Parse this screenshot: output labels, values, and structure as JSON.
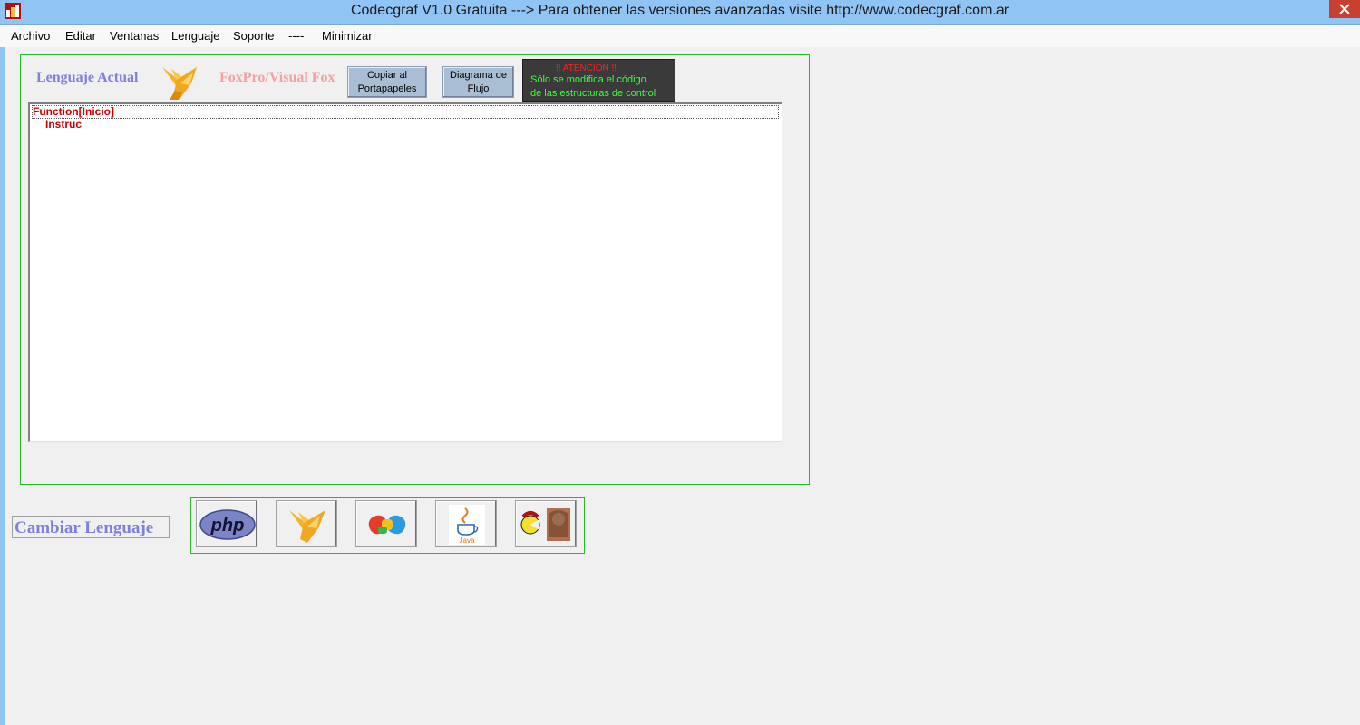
{
  "window": {
    "title": "Codecgraf V1.0 Gratuita ---> Para obtener las versiones avanzadas visite http://www.codecgraf.com.ar"
  },
  "menu": [
    "Archivo",
    "Editar",
    "Ventanas",
    "Lenguaje",
    "Soporte",
    "----",
    "Minimizar"
  ],
  "toolbar": {
    "language_label": "Lenguaje Actual",
    "language_name": "FoxPro/Visual Fox",
    "copy_button": [
      "Copiar al",
      "Portapapeles"
    ],
    "flow_button": [
      "Diagrama de",
      "Flujo"
    ],
    "attention": {
      "title": "!! ATENCION !!",
      "line1": "Sólo se modifica el código",
      "line2": "de las estructuras de control"
    }
  },
  "editor": {
    "lines": [
      "Function[Inicio]",
      "Instruc"
    ]
  },
  "change_language": {
    "label": "Cambiar Lenguaje",
    "php_logo_text": "php",
    "java_logo_text": "Java"
  },
  "colors": {
    "titlebar": "#8fc4f5",
    "panel_border": "#28b828",
    "label_blue": "#7f7fe0",
    "lang_pink": "#f3a0a0",
    "code_red": "#cc0000",
    "attention_red": "#ff2020",
    "attention_green": "#3aff3a"
  }
}
